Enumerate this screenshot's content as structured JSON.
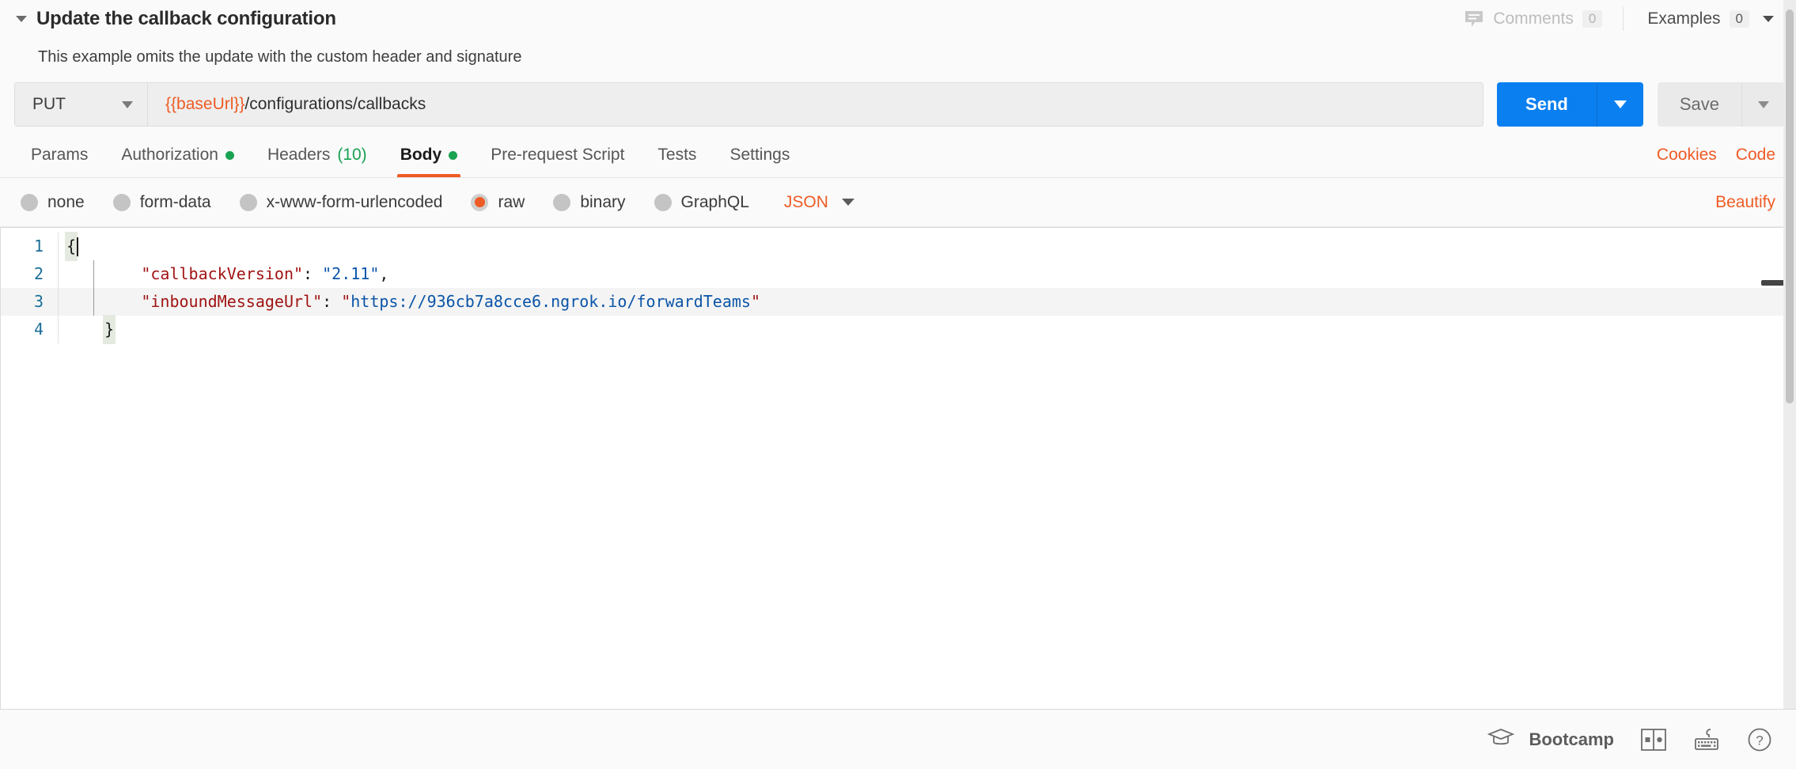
{
  "header": {
    "title": "Update the callback configuration",
    "collapse_icon": "caret-down-icon",
    "comments": {
      "icon": "comment-icon",
      "label": "Comments",
      "count": "0"
    },
    "examples": {
      "label": "Examples",
      "count": "0",
      "caret_icon": "caret-down-icon"
    }
  },
  "description": "This example omits the update with the custom header and signature",
  "request": {
    "method": "PUT",
    "method_caret_icon": "caret-down-icon",
    "url_variable": "{{baseUrl}}",
    "url_path": "/configurations/callbacks",
    "url_full": "{{baseUrl}}/configurations/callbacks",
    "send_label": "Send",
    "send_caret_icon": "caret-down-icon",
    "save_label": "Save",
    "save_caret_icon": "caret-down-icon"
  },
  "tabs": [
    {
      "label": "Params",
      "active": false,
      "dot": false,
      "count": ""
    },
    {
      "label": "Authorization",
      "active": false,
      "dot": true,
      "count": ""
    },
    {
      "label": "Headers",
      "active": false,
      "dot": false,
      "count": "(10)"
    },
    {
      "label": "Body",
      "active": true,
      "dot": true,
      "count": ""
    },
    {
      "label": "Pre-request Script",
      "active": false,
      "dot": false,
      "count": ""
    },
    {
      "label": "Tests",
      "active": false,
      "dot": false,
      "count": ""
    },
    {
      "label": "Settings",
      "active": false,
      "dot": false,
      "count": ""
    }
  ],
  "tab_links": {
    "cookies": "Cookies",
    "code": "Code"
  },
  "body_types": [
    {
      "label": "none",
      "selected": false
    },
    {
      "label": "form-data",
      "selected": false
    },
    {
      "label": "x-www-form-urlencoded",
      "selected": false
    },
    {
      "label": "raw",
      "selected": true
    },
    {
      "label": "binary",
      "selected": false
    },
    {
      "label": "GraphQL",
      "selected": false
    }
  ],
  "body_format": {
    "label": "JSON",
    "caret_icon": "caret-down-icon"
  },
  "beautify_label": "Beautify",
  "editor": {
    "lines": [
      {
        "number": "1",
        "text": "{"
      },
      {
        "number": "2",
        "text": "    \"callbackVersion\": \"2.11\","
      },
      {
        "number": "3",
        "text": "    \"inboundMessageUrl\": \"https://936cb7a8cce6.ngrok.io/forwardTeams\""
      },
      {
        "number": "4",
        "text": "}"
      }
    ],
    "line1_brace": "{",
    "line2_key": "\"callbackVersion\"",
    "line2_colon": ": ",
    "line2_value": "\"2.11\"",
    "line2_comma": ",",
    "line3_key": "\"inboundMessageUrl\"",
    "line3_colon": ": ",
    "line3_quote_open": "\"",
    "line3_value": "https://936cb7a8cce6.ngrok.io/forwardTeams",
    "line3_quote_close": "\"",
    "line4_brace": "}",
    "active_line": "3"
  },
  "status_bar": {
    "bootcamp_icon": "graduation-cap-icon",
    "bootcamp_label": "Bootcamp",
    "layout_icon": "two-pane-layout-icon",
    "keyboard_icon": "keyboard-shortcuts-icon",
    "help_icon": "help-circle-icon"
  },
  "colors": {
    "accent_orange": "#ef5b25",
    "send_blue": "#0a7ff0",
    "status_green": "#19a251",
    "json_key_red": "#a11313",
    "json_string_blue": "#0b55a8",
    "gutter_blue": "#1a6e96"
  }
}
